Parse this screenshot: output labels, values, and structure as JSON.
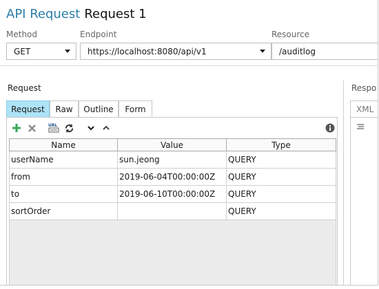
{
  "header": {
    "app_title": "API Request",
    "request_title": "Request 1"
  },
  "form": {
    "method_label": "Method",
    "endpoint_label": "Endpoint",
    "resource_label": "Resource",
    "method_value": "GET",
    "endpoint_value": "https://localhost:8080/api/v1",
    "resource_value": "/auditlog"
  },
  "request": {
    "section_title": "Request",
    "tabs": [
      {
        "label": "Request",
        "active": true
      },
      {
        "label": "Raw"
      },
      {
        "label": "Outline"
      },
      {
        "label": "Form"
      }
    ],
    "toolbar_icons": [
      "add-icon",
      "delete-icon",
      "url-encode-icon",
      "refresh-icon",
      "move-down-icon",
      "move-up-icon",
      "info-icon"
    ],
    "columns": [
      "Name",
      "Value",
      "Type"
    ],
    "rows": [
      {
        "name": "userName",
        "value": "sun.jeong",
        "type": "QUERY"
      },
      {
        "name": "from",
        "value": "2019-06-04T00:00:00Z",
        "type": "QUERY"
      },
      {
        "name": "to",
        "value": "2019-06-10T00:00:00Z",
        "type": "QUERY"
      },
      {
        "name": "sortOrder",
        "value": "",
        "type": "QUERY"
      }
    ]
  },
  "response": {
    "section_title": "Respo",
    "tab_label": "XML"
  },
  "colors": {
    "accent": "#2c7ea8",
    "active_tab": "#aee3f7",
    "add_green": "#3aa655"
  }
}
